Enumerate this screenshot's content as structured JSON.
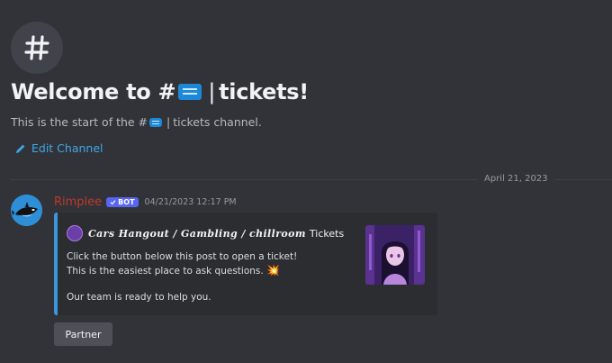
{
  "hero": {
    "icon": "hash-icon",
    "title_prefix": "Welcome to #",
    "title_suffix": "tickets!",
    "ticket_emoji": "ticket-icon",
    "pipe": "|",
    "subtitle_prefix": "This is the start of the #",
    "subtitle_suffix": "tickets channel."
  },
  "edit_channel": {
    "label": "Edit Channel",
    "icon": "pencil-icon"
  },
  "divider": {
    "date": "April 21, 2023"
  },
  "message": {
    "author": "Rimplee",
    "author_color": "#c0392b",
    "badge": "BOT",
    "badge_color": "#5865f2",
    "timestamp": "04/21/2023 12:17 PM",
    "embed": {
      "accent_color": "#3a96dd",
      "author_name": "Cars Hangout / Gambling / chillroom",
      "author_suffix": "Tickets",
      "line1": "Click the button below this post to open a ticket!",
      "line2": "This is the easiest place to ask questions.",
      "line2_emoji": "💥",
      "line3": "Our team is ready to help you."
    },
    "button": {
      "label": "Partner"
    }
  },
  "colors": {
    "background": "#313338",
    "link": "#3fa7e8"
  }
}
